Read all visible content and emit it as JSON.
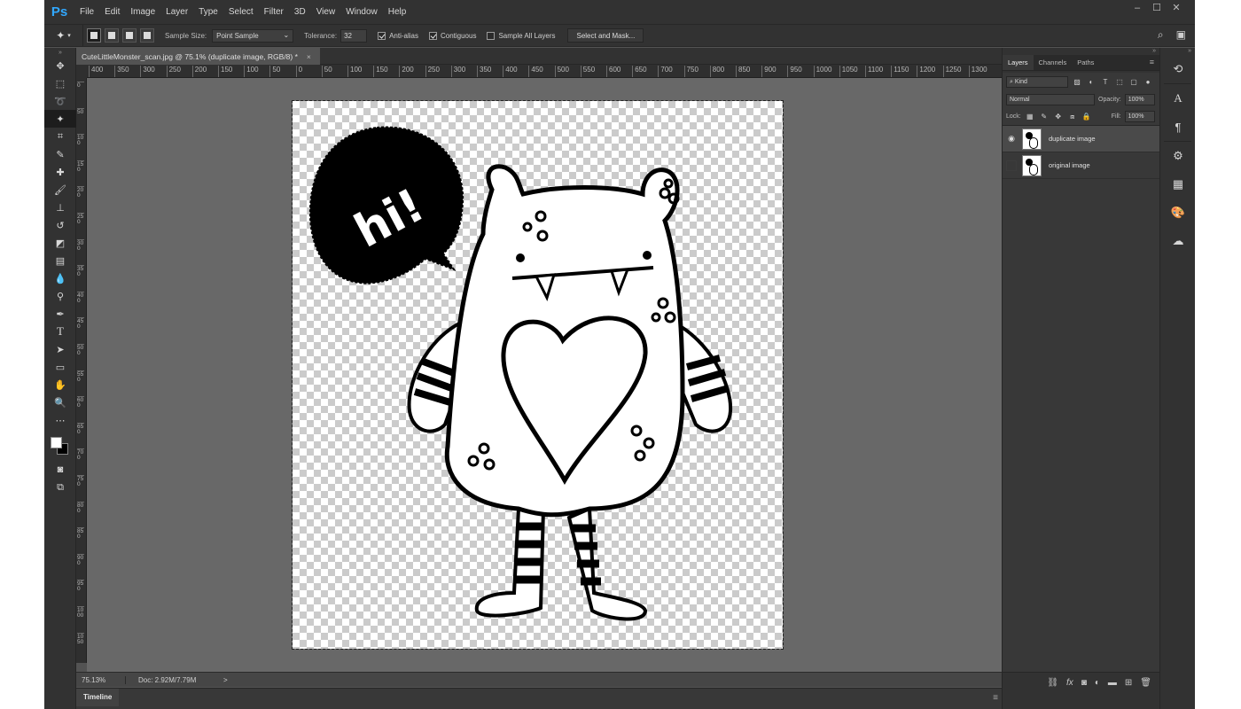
{
  "app": {
    "logo": "Ps",
    "menu": [
      "File",
      "Edit",
      "Image",
      "Layer",
      "Type",
      "Select",
      "Filter",
      "3D",
      "View",
      "Window",
      "Help"
    ],
    "window_controls": [
      "–",
      "☐",
      "✕"
    ]
  },
  "options_bar": {
    "sample_size_label": "Sample Size:",
    "sample_size_value": "Point Sample",
    "tolerance_label": "Tolerance:",
    "tolerance_value": "32",
    "anti_alias_label": "Anti-alias",
    "anti_alias_checked": true,
    "contiguous_label": "Contiguous",
    "contiguous_checked": true,
    "sample_all_label": "Sample All Layers",
    "sample_all_checked": false,
    "select_mask_label": "Select and Mask..."
  },
  "document": {
    "tab_title": "CuteLittleMonster_scan.jpg @ 75.1% (duplicate image, RGB/8) *",
    "close": "×",
    "speech_text": "hi!"
  },
  "rulers": {
    "horizontal": [
      "400",
      "350",
      "300",
      "250",
      "200",
      "150",
      "100",
      "50",
      "0",
      "50",
      "100",
      "150",
      "200",
      "250",
      "300",
      "350",
      "400",
      "450",
      "500",
      "550",
      "600",
      "650",
      "700",
      "750",
      "800",
      "850",
      "900",
      "950",
      "1000",
      "1050",
      "1100",
      "1150",
      "1200",
      "1250",
      "1300"
    ],
    "vertical": [
      "0",
      "50",
      "100",
      "150",
      "200",
      "250",
      "300",
      "350",
      "400",
      "450",
      "500",
      "550",
      "600",
      "650",
      "700",
      "750",
      "800",
      "850",
      "900",
      "950",
      "1000",
      "1050"
    ]
  },
  "status": {
    "zoom": "75.13%",
    "doc": "Doc: 2.92M/7.79M",
    "arrow": ">"
  },
  "timeline": {
    "label": "Timeline"
  },
  "layers_panel": {
    "tabs": [
      "Layers",
      "Channels",
      "Paths"
    ],
    "filter_kind": "Kind",
    "blend_mode": "Normal",
    "opacity_label": "Opacity:",
    "opacity_value": "100%",
    "lock_label": "Lock:",
    "fill_label": "Fill:",
    "fill_value": "100%",
    "layers": [
      {
        "name": "duplicate image",
        "visible": true,
        "selected": true
      },
      {
        "name": "original image",
        "visible": false,
        "selected": false
      }
    ]
  }
}
